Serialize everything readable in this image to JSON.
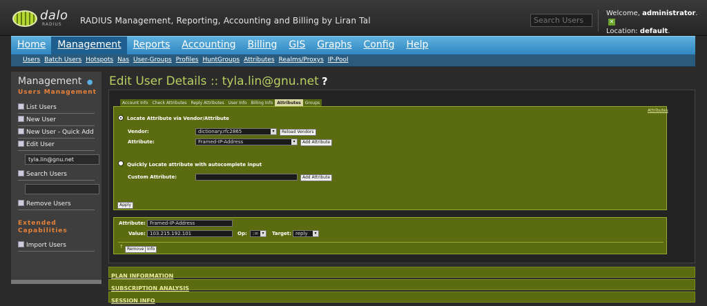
{
  "header": {
    "logo_word": "dalo",
    "logo_sub": "RADIUS",
    "tagline": "RADIUS Management, Reporting, Accounting and Billing by Liran Tal",
    "search_placeholder": "Search Users",
    "welcome_prefix": "Welcome,",
    "username": "administrator",
    "location_prefix": "Location:",
    "location": "default"
  },
  "nav": {
    "items": [
      "Home",
      "Management",
      "Reports",
      "Accounting",
      "Billing",
      "GIS",
      "Graphs",
      "Config",
      "Help"
    ],
    "active": "Management"
  },
  "subnav": [
    "Users",
    "Batch Users",
    "Hotspots",
    "Nas",
    "User-Groups",
    "Profiles",
    "HuntGroups",
    "Attributes",
    "Realms/Proxys",
    "IP-Pool"
  ],
  "sidebar": {
    "title": "Management",
    "section1": "Users Management",
    "list_users": "List Users",
    "new_user": "New User",
    "new_user_quick": "New User - Quick Add",
    "edit_user": "Edit User",
    "edit_user_value": "tyla.lin@gnu.net",
    "search_users": "Search Users",
    "search_value": "",
    "remove_users": "Remove Users",
    "section2": "Extended Capabilities",
    "import_users": "Import Users"
  },
  "page": {
    "title": "Edit User Details :: tyla.lin@gnu.net",
    "help": "?"
  },
  "tabs": [
    "Account Info",
    "Check Attributes",
    "Reply Attributes",
    "User Info",
    "Billing Info",
    "Attributes",
    "Groups"
  ],
  "locate": {
    "attributes_link": "Attributes",
    "radio1_label": "Locate Attribute via Vendor/Attribute",
    "vendor_label": "Vendor:",
    "vendor_value": "dictionary.rfc2865",
    "reload_vendors": "Reload Vendors",
    "attribute_label": "Attribute:",
    "attribute_value": "Framed-IP-Address",
    "add_attribute": "Add Attribute",
    "radio2_label": "Quickly Locate attribute with autocomplete input",
    "custom_label": "Custom Attribute:",
    "custom_value": "",
    "add_attribute2": "Add Attribute",
    "apply": "Apply"
  },
  "selected": {
    "attribute_label": "Attribute:",
    "attribute_value": "Framed-IP-Address",
    "value_label": "Value:",
    "value": "103.215.192.101",
    "op_label": "Op:",
    "op_value": ":=",
    "target_label": "Target:",
    "target_value": "reply",
    "remove": "Remove",
    "info": "Info"
  },
  "accordions": [
    "PLAN INFORMATION",
    "SUBSCRIPTION ANALYSIS",
    "SESSION INFO"
  ]
}
